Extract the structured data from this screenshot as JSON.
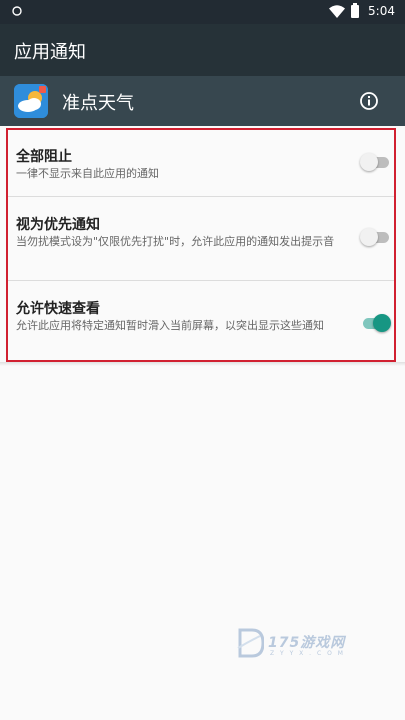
{
  "status_bar": {
    "time": "5:04",
    "icons": [
      "notification-app-icon",
      "wifi-icon",
      "battery-icon"
    ]
  },
  "toolbar": {
    "title": "应用通知"
  },
  "app": {
    "name": "准点天气",
    "icon": "weather-app-icon",
    "info_icon": "info-icon"
  },
  "settings": [
    {
      "label": "全部阻止",
      "description": "一律不显示来自此应用的通知",
      "enabled": false
    },
    {
      "label": "视为优先通知",
      "description": "当勿扰模式设为\"仅限优先打扰\"时，允许此应用的通知发出提示音",
      "enabled": false
    },
    {
      "label": "允许快速查看",
      "description": "允许此应用将特定通知暂时滑入当前屏幕，以突出显示这些通知",
      "enabled": true
    }
  ],
  "watermark": {
    "text": "175游戏网",
    "subtext": "Z Y Y X . C O M"
  },
  "colors": {
    "toolbar": "#263238",
    "app_header": "#37474f",
    "highlight_border": "#d12030",
    "switch_on": "#179683",
    "switch_off": "#bdbdbd"
  }
}
